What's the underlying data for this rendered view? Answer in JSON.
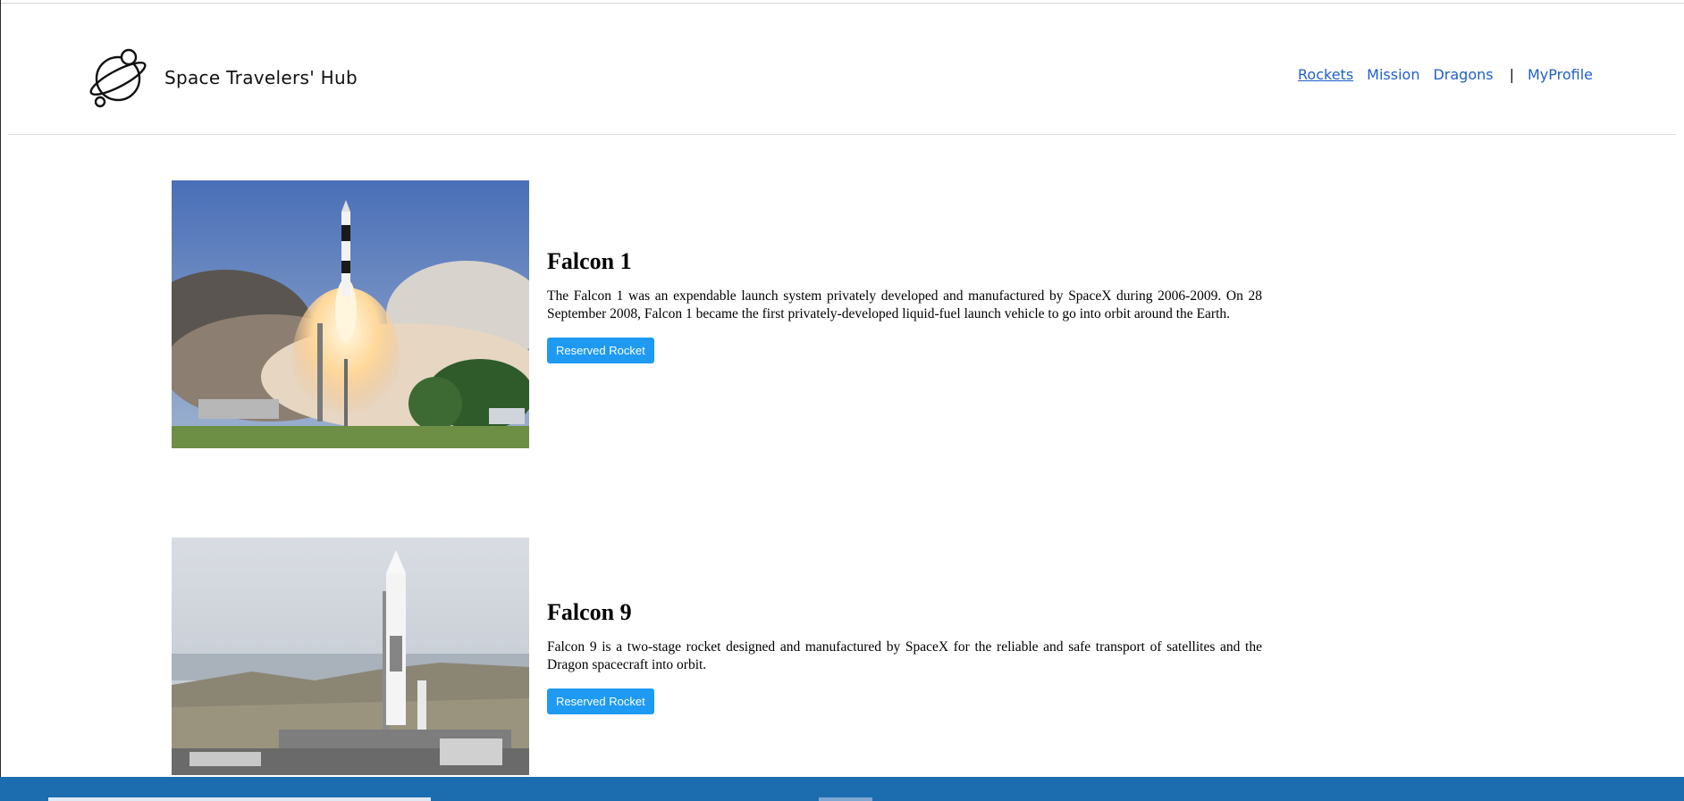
{
  "header": {
    "brand_name": "Space Travelers' Hub",
    "logo_icon": "planet-logo-icon",
    "nav": {
      "rockets": "Rockets",
      "mission": "Mission",
      "dragons": "Dragons",
      "separator": "|",
      "profile": "MyProfile"
    },
    "link_color": "#1f5fc8"
  },
  "rockets": [
    {
      "name": "Falcon 1",
      "description": "The Falcon 1 was an expendable launch system privately developed and manufactured by SpaceX during 2006-2009. On 28 September 2008, Falcon 1 became the first privately-developed liquid-fuel launch vehicle to go into orbit around the Earth.",
      "button_label": "Reserved Rocket"
    },
    {
      "name": "Falcon 9",
      "description": "Falcon 9 is a two-stage rocket designed and manufactured by SpaceX for the reliable and safe transport of satellites and the Dragon spacecraft into orbit.",
      "button_label": "Reserved Rocket"
    }
  ],
  "colors": {
    "button_bg": "#1e9af3",
    "taskbar": "#1c6db0"
  }
}
